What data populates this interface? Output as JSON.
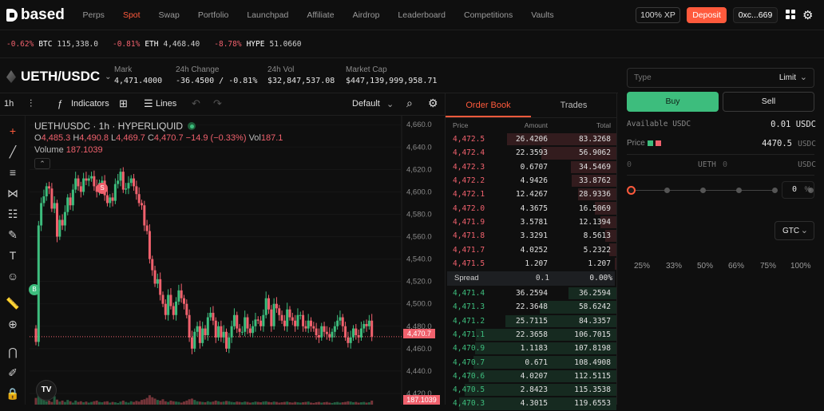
{
  "nav": {
    "brand": "based",
    "links": [
      "Perps",
      "Spot",
      "Swap",
      "Portfolio",
      "Launchpad",
      "Affiliate",
      "Airdrop",
      "Leaderboard",
      "Competitions",
      "Vaults"
    ],
    "active": "Spot",
    "xp": "100% XP",
    "deposit": "Deposit",
    "wallet": "0xc...669",
    "colors": {
      "accent": "#ff5a3c",
      "buy": "#3dbd7d",
      "sell": "#f0616d"
    }
  },
  "ticker": [
    {
      "chg": "-0.62%",
      "sym": "BTC",
      "px": "115,338.0"
    },
    {
      "chg": "-0.81%",
      "sym": "ETH",
      "px": "4,468.40"
    },
    {
      "chg": "-8.78%",
      "sym": "HYPE",
      "px": "51.0660"
    }
  ],
  "market": {
    "pair": "UETH/USDC",
    "mark_label": "Mark",
    "mark": "4,471.4000",
    "change_label": "24h Change",
    "change": "-36.4500 / -0.81%",
    "vol_label": "24h Vol",
    "vol": "$32,847,537.08",
    "cap_label": "Market Cap",
    "cap": "$447,139,999,958.71"
  },
  "chart_toolbar": {
    "interval": "1h",
    "indicators": "Indicators",
    "lines": "Lines",
    "layout": "Default"
  },
  "chart": {
    "title": "UETH/USDC · 1h · HYPERLIQUID",
    "ohlc": {
      "o_label": "O",
      "o": "4,485.3",
      "h_label": "H",
      "h": "4,490.8",
      "l_label": "L",
      "l": "4,469.7",
      "c_label": "C",
      "c": "4,470.7",
      "chg": "−14.9 (−0.33%)",
      "vol_label": "Vol",
      "vol": "187.1"
    },
    "volume_label": "Volume",
    "volume": "187.1039",
    "yticks": [
      "4,660.0",
      "4,640.0",
      "4,620.0",
      "4,600.0",
      "4,580.0",
      "4,560.0",
      "4,540.0",
      "4,520.0",
      "4,500.0",
      "4,480.0",
      "4,460.0",
      "4,440.0",
      "4,420.0"
    ],
    "price_tag": "4,470.7",
    "vol_tag": "187.1039",
    "marker_s": "S",
    "marker_b": "B",
    "tv": "TV",
    "chart_data": {
      "type": "candlestick",
      "ylim": [
        4410,
        4668
      ],
      "last_close": 4470.7,
      "opens": [
        4478,
        4466,
        4570,
        4590,
        4596,
        4605,
        4603,
        4585,
        4590,
        4560,
        4575,
        4570,
        4582,
        4595,
        4588,
        4602,
        4612,
        4605,
        4600,
        4612,
        4610,
        4612,
        4614,
        4605,
        4600,
        4608,
        4610,
        4597,
        4590,
        4595,
        4592,
        4607,
        4610,
        4618,
        4602,
        4603,
        4608,
        4612,
        4605,
        4598,
        4590,
        4588,
        4570,
        4565,
        4540,
        4530,
        4518,
        4522,
        4508,
        4500,
        4490,
        4508,
        4498,
        4490,
        4502,
        4512,
        4505,
        4500,
        4490,
        4470,
        4460,
        4475,
        4480,
        4465,
        4478,
        4472,
        4488,
        4492,
        4485,
        4470,
        4480,
        4470,
        4475,
        4460,
        4470,
        4480,
        4490,
        4478,
        4475,
        4475,
        4488,
        4478,
        4474,
        4480,
        4486,
        4485,
        4480,
        4490,
        4505,
        4495,
        4480,
        4500,
        4496,
        4490,
        4485,
        4480,
        4495,
        4488,
        4485,
        4480,
        4490,
        4490,
        4480,
        4478,
        4485,
        4480,
        4478,
        4472,
        4470,
        4480,
        4475,
        4473,
        4470,
        4475,
        4480,
        4485,
        4488,
        4480,
        4470,
        4465,
        4470,
        4478,
        4472,
        4470,
        4478,
        4482,
        4480,
        4485
      ],
      "closes": [
        4466,
        4570,
        4590,
        4596,
        4605,
        4603,
        4585,
        4590,
        4560,
        4575,
        4570,
        4582,
        4595,
        4588,
        4602,
        4612,
        4605,
        4600,
        4612,
        4610,
        4612,
        4614,
        4605,
        4600,
        4608,
        4610,
        4597,
        4590,
        4595,
        4592,
        4607,
        4610,
        4618,
        4602,
        4603,
        4608,
        4612,
        4605,
        4598,
        4590,
        4588,
        4570,
        4565,
        4540,
        4530,
        4518,
        4522,
        4508,
        4500,
        4490,
        4508,
        4498,
        4490,
        4502,
        4512,
        4505,
        4500,
        4490,
        4470,
        4460,
        4475,
        4480,
        4465,
        4478,
        4472,
        4488,
        4492,
        4485,
        4470,
        4480,
        4470,
        4475,
        4460,
        4470,
        4480,
        4490,
        4478,
        4475,
        4475,
        4488,
        4478,
        4474,
        4480,
        4486,
        4485,
        4480,
        4490,
        4505,
        4495,
        4480,
        4500,
        4496,
        4490,
        4485,
        4480,
        4495,
        4488,
        4485,
        4480,
        4490,
        4490,
        4480,
        4478,
        4485,
        4480,
        4478,
        4472,
        4470,
        4480,
        4475,
        4473,
        4470,
        4475,
        4480,
        4485,
        4488,
        4480,
        4470,
        4465,
        4470,
        4478,
        4472,
        4470,
        4478,
        4482,
        4480,
        4485,
        4470.7
      ],
      "volumes": [
        20,
        55,
        30,
        35,
        10,
        12,
        8,
        25,
        15,
        9,
        12,
        8,
        14,
        10,
        6,
        12,
        8,
        10,
        7,
        9,
        6,
        8,
        10,
        12,
        8,
        7,
        9,
        10,
        6,
        8,
        7,
        5,
        9,
        12,
        8,
        6,
        10,
        8,
        11,
        9,
        14,
        16,
        20,
        28,
        22,
        18,
        14,
        12,
        16,
        10,
        8,
        12,
        10,
        9,
        8,
        6,
        9,
        12,
        16,
        18,
        14,
        10,
        9,
        8,
        7,
        10,
        8,
        9,
        12,
        10,
        8,
        9,
        11,
        10,
        8,
        7,
        9,
        8,
        7,
        9,
        8,
        6,
        7,
        9,
        8,
        7,
        9,
        10,
        8,
        7,
        9,
        8,
        6,
        7,
        8,
        9,
        7,
        6,
        8,
        7,
        6,
        7,
        8,
        9,
        6,
        5,
        7,
        8,
        6,
        7,
        8,
        6,
        5,
        7,
        8,
        6,
        7,
        8,
        10,
        9,
        7,
        8,
        6,
        7,
        8,
        6,
        7,
        12
      ]
    }
  },
  "orderbook": {
    "tabs": [
      "Order Book",
      "Trades"
    ],
    "cols": [
      "Price",
      "Amount",
      "Total"
    ],
    "asks": [
      [
        "4,472.5",
        "26.4206",
        "83.3268"
      ],
      [
        "4,472.4",
        "22.3593",
        "56.9062"
      ],
      [
        "4,472.3",
        "0.6707",
        "34.5469"
      ],
      [
        "4,472.2",
        "4.9426",
        "33.8762"
      ],
      [
        "4,472.1",
        "12.4267",
        "28.9336"
      ],
      [
        "4,472.0",
        "4.3675",
        "16.5069"
      ],
      [
        "4,471.9",
        "3.5781",
        "12.1394"
      ],
      [
        "4,471.8",
        "3.3291",
        "8.5613"
      ],
      [
        "4,471.7",
        "4.0252",
        "5.2322"
      ],
      [
        "4,471.5",
        "1.207",
        "1.207"
      ]
    ],
    "spread": [
      "Spread",
      "0.1",
      "0.00%"
    ],
    "bids": [
      [
        "4,471.4",
        "36.2594",
        "36.2594"
      ],
      [
        "4,471.3",
        "22.3648",
        "58.6242"
      ],
      [
        "4,471.2",
        "25.7115",
        "84.3357"
      ],
      [
        "4,471.1",
        "22.3658",
        "106.7015"
      ],
      [
        "4,470.9",
        "1.1183",
        "107.8198"
      ],
      [
        "4,470.7",
        "0.671",
        "108.4908"
      ],
      [
        "4,470.6",
        "4.0207",
        "112.5115"
      ],
      [
        "4,470.5",
        "2.8423",
        "115.3538"
      ],
      [
        "4,470.3",
        "4.3015",
        "119.6553"
      ]
    ]
  },
  "order": {
    "type_label": "Type",
    "type": "Limit",
    "buy": "Buy",
    "sell": "Sell",
    "avail_label": "Available USDC",
    "avail": "0.01 USDC",
    "price_label": "Price",
    "price": "4470.5",
    "price_unit": "USDC",
    "amt_zero": "0",
    "amt_unit": "UETH",
    "total_zero": "0",
    "total_unit": "USDC",
    "pct_val": "0",
    "pct_sign": "%",
    "slider_value": 0,
    "pcts": [
      "25%",
      "33%",
      "50%",
      "66%",
      "75%",
      "100%"
    ],
    "tif": "GTC"
  }
}
